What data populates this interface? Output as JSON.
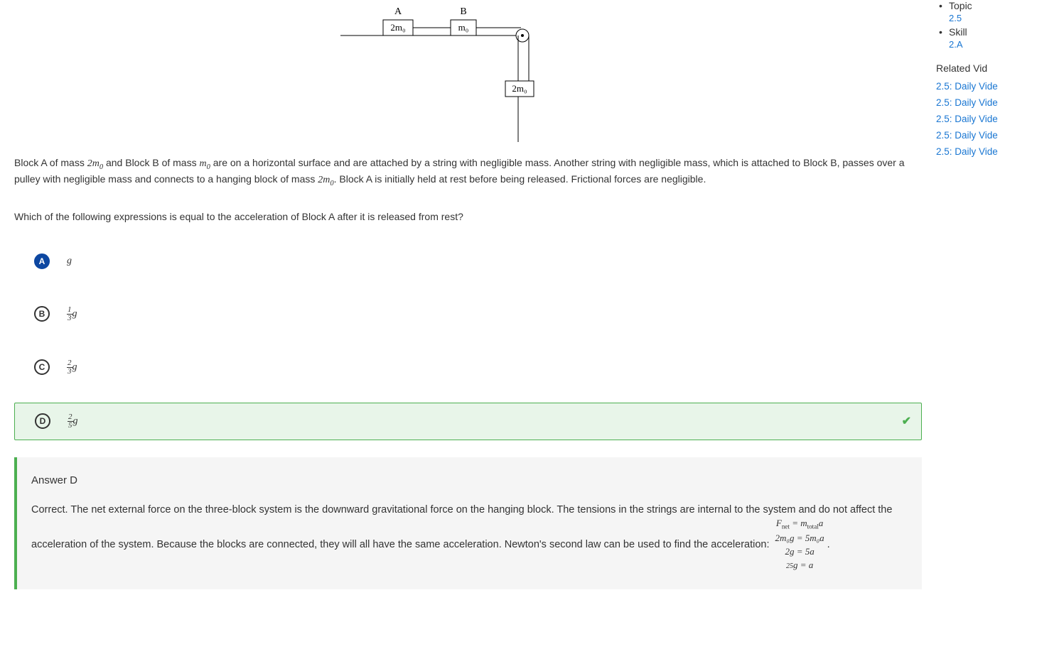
{
  "diagram": {
    "labelA": "A",
    "labelB": "B",
    "massA": "2m₀",
    "massB": "m₀",
    "massHanging": "2m₀"
  },
  "problem_text": {
    "part1": "Block A of mass ",
    "mass1": "2m",
    "sub1": "0",
    "part2": " and Block B of mass ",
    "mass2": "m",
    "sub2": "0",
    "part3": " are on a horizontal surface and are attached by a string with negligible mass. Another string with negligible mass, which is attached to Block B, passes over a pulley with negligible mass and connects to a hanging block of mass ",
    "mass3": "2m",
    "sub3": "0",
    "part4": ". Block A is initially held at rest before being released. Frictional forces are negligible."
  },
  "question": "Which of the following expressions is equal to the acceleration of Block A after it is released from rest?",
  "options": {
    "A": {
      "letter": "A",
      "num": "",
      "den": "",
      "var": "g",
      "selected": true
    },
    "B": {
      "letter": "B",
      "num": "1",
      "den": "3",
      "var": "g"
    },
    "C": {
      "letter": "C",
      "num": "2",
      "den": "3",
      "var": "g"
    },
    "D": {
      "letter": "D",
      "num": "2",
      "den": "5",
      "var": "g",
      "correct": true
    }
  },
  "explanation": {
    "title": "Answer D",
    "body_part1": "Correct. The net external force on the three-block system is the downward gravitational force on the hanging block. The tensions in the strings are internal to the system and do not affect the acceleration of the system. Because the blocks are connected, they will all have the same acceleration. Newton's second law can be used to find the acceleration: ",
    "eq1_lhs": "F",
    "eq1_sub": "net",
    "eq1_mid": " = ",
    "eq1_rhs": "m",
    "eq1_rsub": "total",
    "eq1_end": "a",
    "eq2": "2m₀g = 5m₀a",
    "eq3": "2g = 5a",
    "eq4_frac_num": "2",
    "eq4_frac_den": "5",
    "eq4_rest": "g = a",
    "period": "."
  },
  "sidebar": {
    "topic_label": "Topic",
    "topic_value": "2.5",
    "skill_label": "Skill",
    "skill_value": "2.A",
    "related_title": "Related Vid",
    "videos": [
      "2.5: Daily Vide",
      "2.5: Daily Vide",
      "2.5: Daily Vide",
      "2.5: Daily Vide",
      "2.5: Daily Vide"
    ]
  }
}
